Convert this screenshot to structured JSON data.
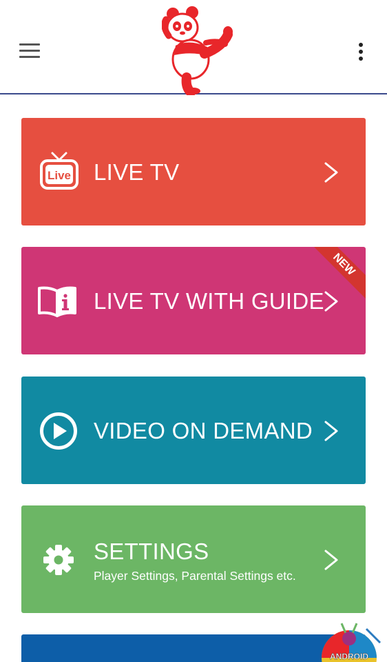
{
  "header": {
    "menu_icon": "hamburger-menu-icon",
    "logo_icon": "panda-logo-icon",
    "overflow_icon": "more-vertical-icon",
    "divider_color": "#3b4a8c"
  },
  "tiles": [
    {
      "label": "LIVE TV",
      "color": "#e64f40",
      "icon": "live-tv-icon",
      "icon_text": "Live"
    },
    {
      "label": "LIVE TV WITH GUIDE",
      "color": "#cf3675",
      "icon": "guide-book-icon",
      "badge": "NEW",
      "badge_color": "#d3352f"
    },
    {
      "label": "VIDEO ON DEMAND",
      "color": "#118aa2",
      "icon": "play-circle-icon"
    },
    {
      "label": "SETTINGS",
      "subtitle": "Player Settings, Parental Settings etc.",
      "color": "#6cb665",
      "icon": "gear-icon"
    },
    {
      "label": "",
      "color": "#0d5ea8"
    }
  ],
  "watermark": {
    "text": "ANDROID",
    "icon": "android-watermark-icon"
  }
}
